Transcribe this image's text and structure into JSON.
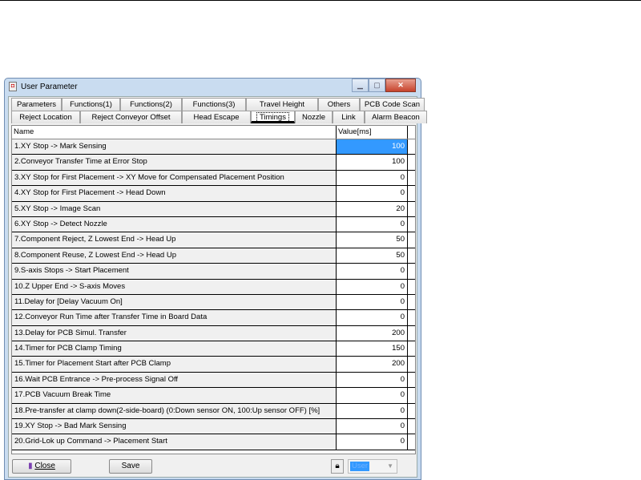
{
  "window": {
    "title": "User Parameter",
    "minimize": "▁",
    "maximize": "▢",
    "close": "✕"
  },
  "tabs_row1": [
    "Parameters",
    "Functions(1)",
    "Functions(2)",
    "Functions(3)",
    "Travel Height",
    "Others",
    "PCB Code Scan"
  ],
  "tabs_row2": [
    "Reject Location",
    "Reject Conveyor Offset",
    "Head Escape",
    "Timings",
    "Nozzle",
    "Link",
    "Alarm Beacon"
  ],
  "active_tab": "Timings",
  "table": {
    "headers": [
      "Name",
      "Value[ms]"
    ],
    "rows": [
      [
        "1.XY Stop -> Mark Sensing",
        "100"
      ],
      [
        "2.Conveyor Transfer Time at Error Stop",
        "100"
      ],
      [
        "3.XY Stop for First Placement -> XY Move for Compensated Placement Position",
        "0"
      ],
      [
        "4.XY Stop for First Placement -> Head Down",
        "0"
      ],
      [
        "5.XY Stop -> Image Scan",
        "20"
      ],
      [
        "6.XY Stop -> Detect Nozzle",
        "0"
      ],
      [
        "7.Component Reject, Z Lowest End -> Head Up",
        "50"
      ],
      [
        "8.Component Reuse, Z Lowest End -> Head Up",
        "50"
      ],
      [
        "9.S-axis Stops -> Start Placement",
        "0"
      ],
      [
        "10.Z Upper End -> S-axis Moves",
        "0"
      ],
      [
        "11.Delay for [Delay Vacuum On]",
        "0"
      ],
      [
        "12.Conveyor Run Time after Transfer Time in Board Data",
        "0"
      ],
      [
        "13.Delay for PCB Simul. Transfer",
        "200"
      ],
      [
        "14.Timer for PCB Clamp Timing",
        "150"
      ],
      [
        "15.Timer for Placement Start after PCB Clamp",
        "200"
      ],
      [
        "16.Wait PCB Entrance -> Pre-process Signal Off",
        "0"
      ],
      [
        "17.PCB Vacuum Break Time",
        "0"
      ],
      [
        "18.Pre-transfer at clamp down(2-side-board) (0:Down sensor ON, 100:Up sensor OFF) [%]",
        "0"
      ],
      [
        "19.XY Stop -> Bad Mark Sensing",
        "0"
      ],
      [
        "20.Grid-Lok up Command -> Placement Start",
        "0"
      ]
    ]
  },
  "buttons": {
    "close": "Close",
    "save": "Save"
  },
  "user_combo": "User",
  "colors": {
    "selection": "#3399ff"
  }
}
